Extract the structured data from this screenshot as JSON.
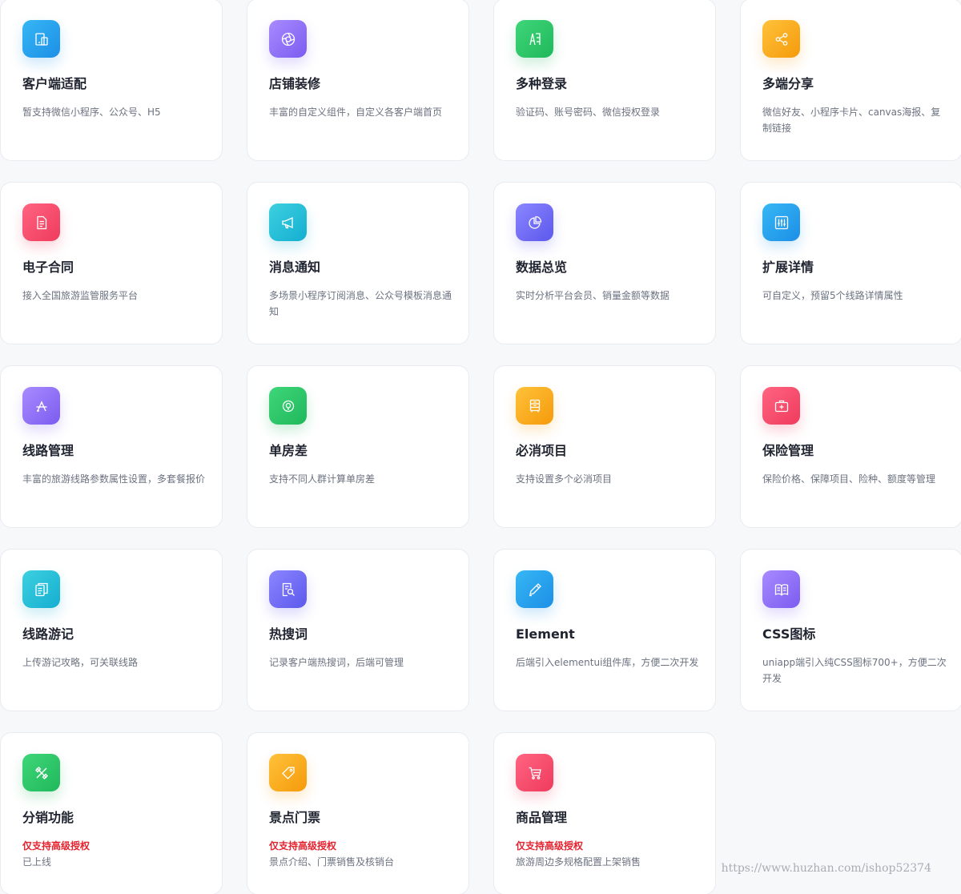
{
  "features": [
    {
      "title": "客户端适配",
      "desc": "暂支持微信小程序、公众号、H5",
      "icon": "device-icon",
      "color": "#1d8fe6"
    },
    {
      "title": "店铺装修",
      "desc": "丰富的自定义组件，自定义各客户端首页",
      "icon": "aperture-icon",
      "color": "#7b5cf0"
    },
    {
      "title": "多种登录",
      "desc": "验证码、账号密码、微信授权登录",
      "icon": "login-icon",
      "color": "#1fb85a"
    },
    {
      "title": "多端分享",
      "desc": "微信好友、小程序卡片、canvas海报、复制链接",
      "icon": "share-icon",
      "color": "#f59a0b"
    },
    {
      "title": "电子合同",
      "desc": "接入全国旅游监管服务平台",
      "icon": "document-icon",
      "color": "#ef3b5c"
    },
    {
      "title": "消息通知",
      "desc": "多场景小程序订阅消息、公众号模板消息通知",
      "icon": "megaphone-icon",
      "color": "#14aed0"
    },
    {
      "title": "数据总览",
      "desc": "实时分析平台会员、销量金额等数据",
      "icon": "pie-chart-icon",
      "color": "#5c58ec"
    },
    {
      "title": "扩展详情",
      "desc": "可自定义，预留5个线路详情属性",
      "icon": "sliders-icon",
      "color": "#1d8fe6"
    },
    {
      "title": "线路管理",
      "desc": "丰富的旅游线路参数属性设置，多套餐报价",
      "icon": "route-icon",
      "color": "#7b5cf0"
    },
    {
      "title": "单房差",
      "desc": "支持不同人群计算单房差",
      "icon": "room-icon",
      "color": "#1fb85a"
    },
    {
      "title": "必消项目",
      "desc": "支持设置多个必消项目",
      "icon": "cabinet-icon",
      "color": "#f59a0b"
    },
    {
      "title": "保险管理",
      "desc": "保险价格、保障项目、险种、额度等管理",
      "icon": "medical-kit-icon",
      "color": "#ef3b5c"
    },
    {
      "title": "线路游记",
      "desc": "上传游记攻略，可关联线路",
      "icon": "notes-icon",
      "color": "#14aed0"
    },
    {
      "title": "热搜词",
      "desc": "记录客户端热搜词，后端可管理",
      "icon": "search-doc-icon",
      "color": "#5c58ec"
    },
    {
      "title": "Element",
      "desc": "后端引入elementui组件库，方便二次开发",
      "icon": "pen-icon",
      "color": "#1d8fe6"
    },
    {
      "title": "CSS图标",
      "desc": "uniapp端引入纯CSS图标700+，方便二次开发",
      "icon": "book-icon",
      "color": "#7b5cf0"
    },
    {
      "title": "分销功能",
      "badge": "仅支持高级授权",
      "desc": "已上线",
      "icon": "tools-icon",
      "color": "#1fb85a"
    },
    {
      "title": "景点门票",
      "badge": "仅支持高级授权",
      "desc": "景点介绍、门票销售及核销台",
      "icon": "tag-icon",
      "color": "#f59a0b"
    },
    {
      "title": "商品管理",
      "badge": "仅支持高级授权",
      "desc": "旅游周边多规格配置上架销售",
      "icon": "cart-icon",
      "color": "#ef3b5c"
    }
  ],
  "watermark": "https://www.huzhan.com/ishop52374"
}
